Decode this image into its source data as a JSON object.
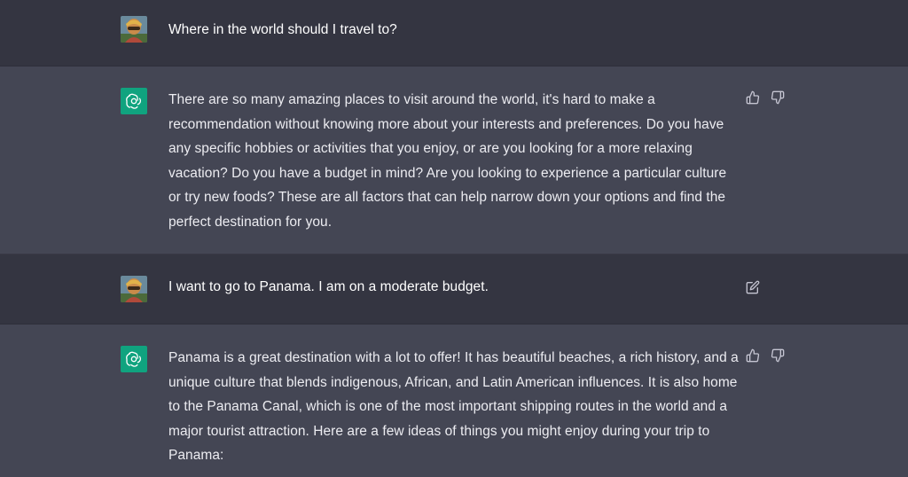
{
  "conversation": {
    "messages": [
      {
        "role": "user",
        "text": "Where in the world should I travel to?"
      },
      {
        "role": "assistant",
        "text": "There are so many amazing places to visit around the world, it's hard to make a recommendation without knowing more about your interests and preferences. Do you have any specific hobbies or activities that you enjoy, or are you looking for a more relaxing vacation? Do you have a budget in mind? Are you looking to experience a particular culture or try new foods? These are all factors that can help narrow down your options and find the perfect destination for you."
      },
      {
        "role": "user",
        "text": "I want to go to Panama. I am on a moderate budget."
      },
      {
        "role": "assistant",
        "text": "Panama is a great destination with a lot to offer! It has beautiful beaches, a rich history, and a unique culture that blends indigenous, African, and Latin American influences. It is also home to the Panama Canal, which is one of the most important shipping routes in the world and a major tourist attraction. Here are a few ideas of things you might enjoy during your trip to Panama:"
      }
    ]
  },
  "icons": {
    "thumbs_up": "thumbs-up-icon",
    "thumbs_down": "thumbs-down-icon",
    "edit": "edit-icon",
    "bot": "openai-logo-icon",
    "user": "user-avatar"
  },
  "colors": {
    "user_row_bg": "#343541",
    "assistant_row_bg": "#444654",
    "bot_avatar_bg": "#10a37f",
    "text": "#ececf1",
    "icon": "#c5c5d2"
  }
}
